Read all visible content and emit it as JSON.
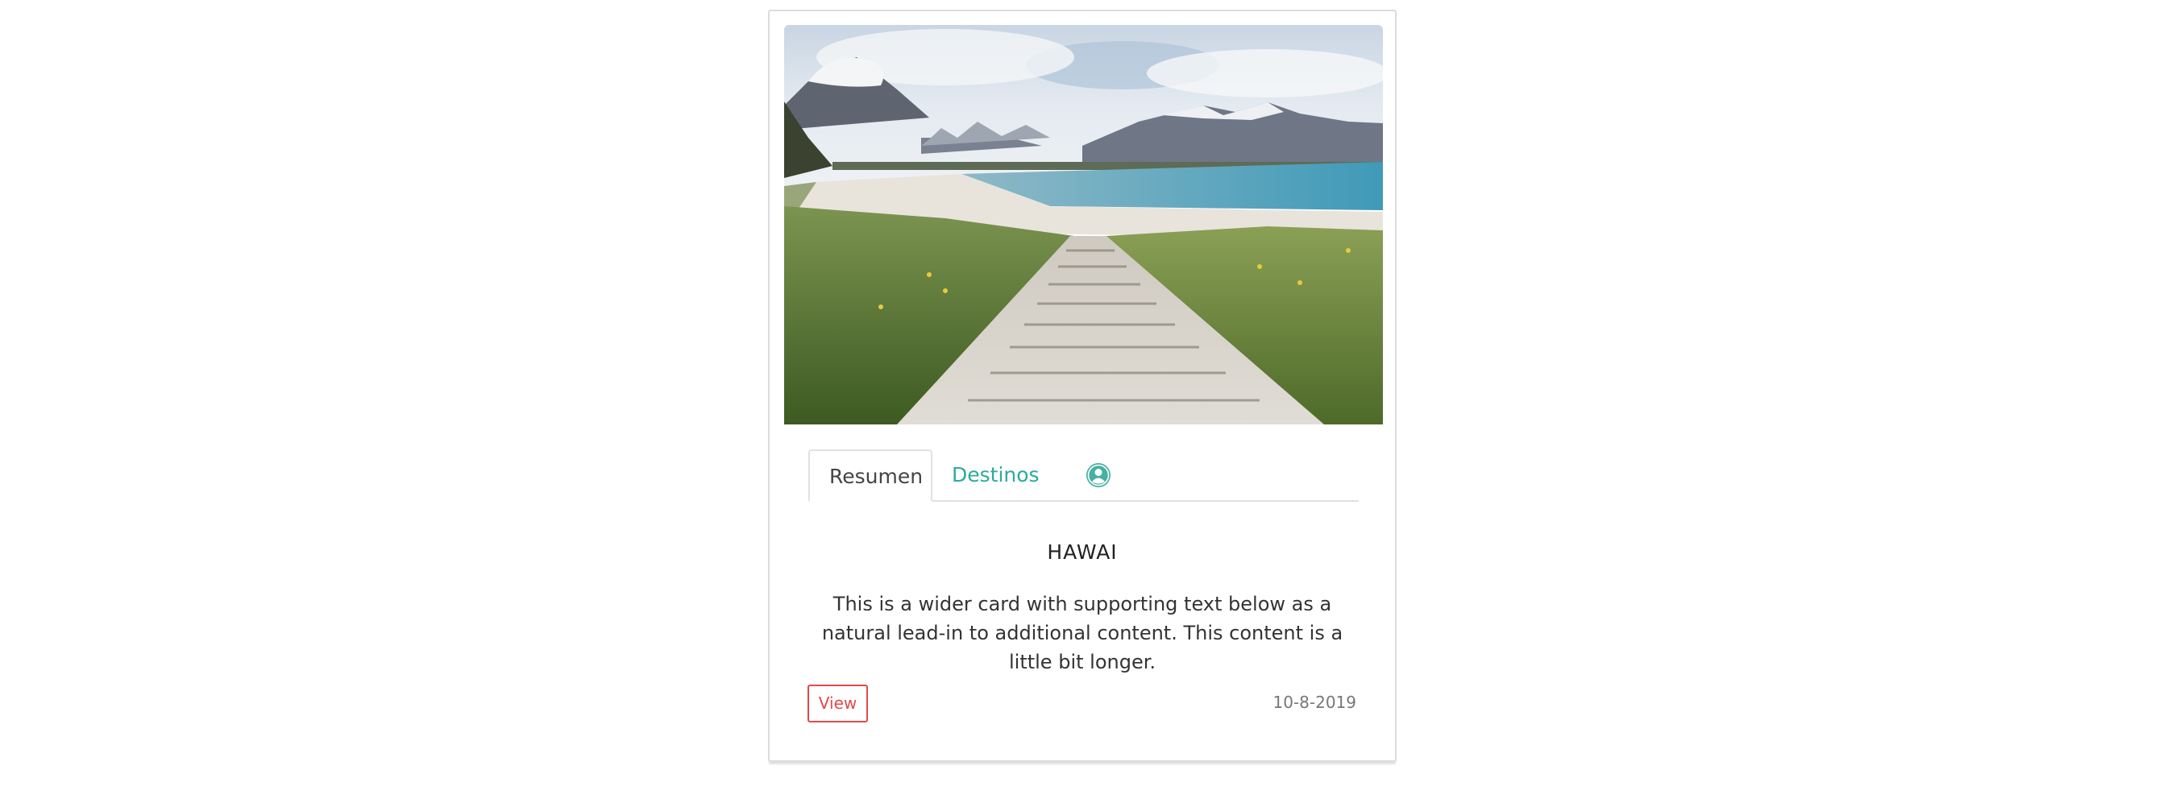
{
  "card": {
    "tabs": [
      {
        "label": "Resumen",
        "active": true
      },
      {
        "label": "Destinos",
        "active": false
      }
    ],
    "profile_icon": "user-circle-icon",
    "title": "HAWAI",
    "text": "This is a wider card with supporting text below as a natural lead-in to additional content. This content is a little bit longer.",
    "view_label": "View",
    "date": "10-8-2019"
  },
  "colors": {
    "accent_teal": "#2bab9b",
    "view_red": "#e04a4a"
  }
}
